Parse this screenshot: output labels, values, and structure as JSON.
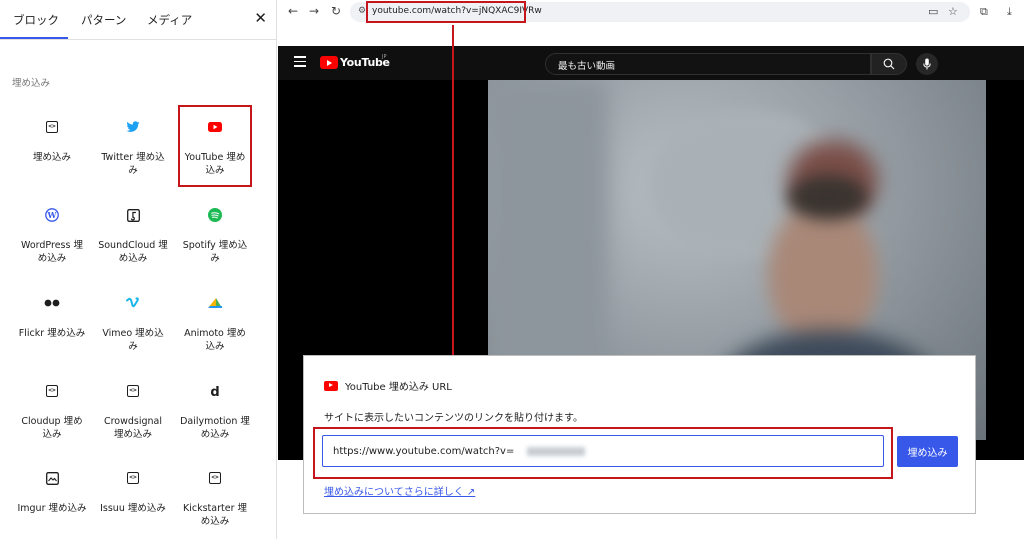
{
  "inserter": {
    "tabs": [
      "ブロック",
      "パターン",
      "メディア"
    ],
    "active_tab": "ブロック",
    "section_title": "埋め込み",
    "blocks": [
      {
        "label": "埋め込み",
        "icon": "embed-generic-icon"
      },
      {
        "label": "Twitter 埋め込み",
        "icon": "twitter-icon"
      },
      {
        "label": "YouTube 埋め込み",
        "icon": "youtube-icon",
        "selected": true
      },
      {
        "label": "WordPress 埋め込み",
        "icon": "wordpress-icon"
      },
      {
        "label": "SoundCloud 埋め込み",
        "icon": "soundcloud-icon"
      },
      {
        "label": "Spotify 埋め込み",
        "icon": "spotify-icon"
      },
      {
        "label": "Flickr 埋め込み",
        "icon": "flickr-icon"
      },
      {
        "label": "Vimeo 埋め込み",
        "icon": "vimeo-icon"
      },
      {
        "label": "Animoto 埋め込み",
        "icon": "animoto-icon"
      },
      {
        "label": "Cloudup 埋め込み",
        "icon": "embed-generic-icon"
      },
      {
        "label": "Crowdsignal 埋め込み",
        "icon": "embed-generic-icon"
      },
      {
        "label": "Dailymotion 埋め込み",
        "icon": "dailymotion-icon"
      },
      {
        "label": "Imgur 埋め込み",
        "icon": "imgur-icon"
      },
      {
        "label": "Issuu 埋め込み",
        "icon": "embed-generic-icon"
      },
      {
        "label": "Kickstarter 埋め込み",
        "icon": "embed-generic-icon"
      }
    ],
    "close_glyph": "✕"
  },
  "browser": {
    "url": "youtube.com/watch?v=jNQXAC9IVRw"
  },
  "youtube": {
    "logo_text": "YouTube",
    "region": "JP",
    "search_value": "最も古い動画"
  },
  "embed_dialog": {
    "title": "YouTube 埋め込み URL",
    "instruction": "サイトに表示したいコンテンツのリンクを貼り付けます。",
    "input_value": "https://www.youtube.com/watch?v=",
    "button_label": "埋め込み",
    "learn_more": "埋め込みについてさらに詳しく ↗"
  },
  "colors": {
    "accent": "#3858e9",
    "highlight": "#c4161c",
    "youtube_red": "#ff0000",
    "yt_header": "#0f0f0f"
  }
}
